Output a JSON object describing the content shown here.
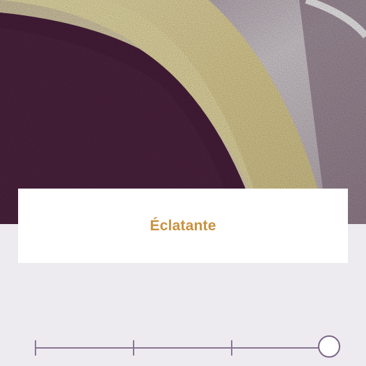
{
  "hero_image": {
    "description": "texture-photo",
    "colors": {
      "plum": "#4a1f3c",
      "cream": "#e8dca8",
      "stone": "#c8c0c6"
    }
  },
  "option": {
    "label": "Éclatante"
  },
  "slider": {
    "steps": 4,
    "selected_index": 3,
    "value_fraction": 1.0,
    "track_color": "#8a7594"
  }
}
